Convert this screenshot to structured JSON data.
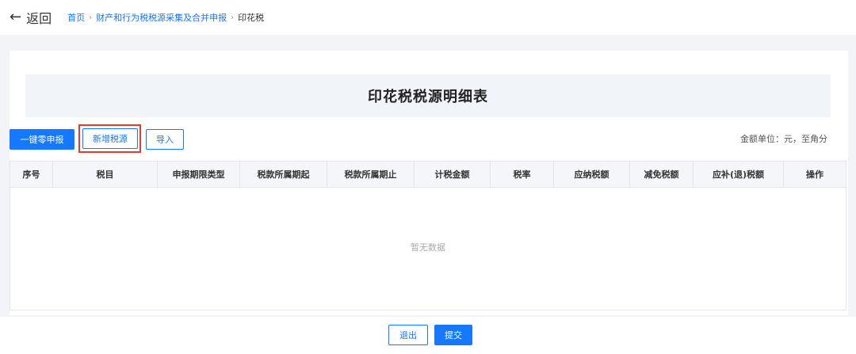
{
  "topbar": {
    "back_label": "返回",
    "breadcrumb": [
      "首页",
      "财产和行为税税源采集及合并申报",
      "印花税"
    ]
  },
  "page": {
    "title": "印花税税源明细表",
    "unit_note": "金额单位：元，至角分"
  },
  "toolbar": {
    "zero_declare_label": "一键零申报",
    "add_source_label": "新增税源",
    "import_label": "导入"
  },
  "table": {
    "columns": [
      "序号",
      "税目",
      "申报期限类型",
      "税款所属期起",
      "税款所属期止",
      "计税金额",
      "税率",
      "应纳税额",
      "减免税额",
      "应补(退)税额",
      "操作"
    ],
    "empty_text": "暂无数据"
  },
  "footer": {
    "exit_label": "退出",
    "submit_label": "提交"
  },
  "colors": {
    "accent": "#1677ff",
    "highlight": "#e53935"
  }
}
